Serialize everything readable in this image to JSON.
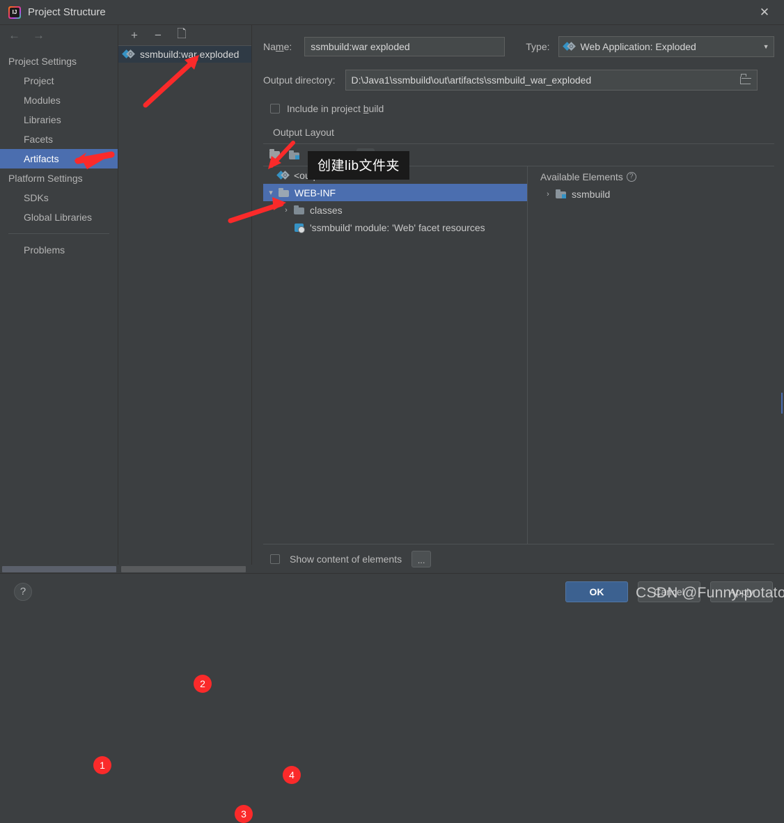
{
  "window": {
    "title": "Project Structure",
    "close_icon": "close-icon",
    "app_icon": "intellij-idea-logo"
  },
  "sidebar": {
    "back_icon": "arrow-left-icon",
    "forward_icon": "arrow-right-icon",
    "groups": [
      {
        "label": "Project Settings",
        "items": [
          {
            "label": "Project",
            "selected": false
          },
          {
            "label": "Modules",
            "selected": false
          },
          {
            "label": "Libraries",
            "selected": false
          },
          {
            "label": "Facets",
            "selected": false
          },
          {
            "label": "Artifacts",
            "selected": true
          }
        ]
      },
      {
        "label": "Platform Settings",
        "items": [
          {
            "label": "SDKs",
            "selected": false
          },
          {
            "label": "Global Libraries",
            "selected": false
          }
        ]
      }
    ],
    "problems_label": "Problems"
  },
  "artifacts_panel": {
    "toolbar": {
      "add_label": "+",
      "remove_label": "−",
      "copy_icon": "copy-icon"
    },
    "items": [
      {
        "label": "ssmbuild:war exploded",
        "selected": true,
        "icon": "artifact-icon"
      }
    ]
  },
  "form": {
    "name_label_before": "Na",
    "name_label_mnemonic": "m",
    "name_label_after": "e:",
    "name_value": "ssmbuild:war exploded",
    "type_label": "Type:",
    "type_value": "Web Application: Exploded",
    "type_icon": "artifact-icon",
    "type_dropdown_icon": "chevron-down-icon",
    "output_dir_label": "Output directory:",
    "output_dir_value": "D:\\Java1\\ssmbuild\\out\\artifacts\\ssmbuild_war_exploded",
    "browse_icon": "folder-browse-icon",
    "include_in_build_before": "Include in project ",
    "include_in_build_mnemonic": "b",
    "include_in_build_after": "uild",
    "include_in_build_checked": false,
    "output_layout_label": "Output Layout"
  },
  "layout_toolbar": {
    "create_dir_icon": "create-directory-icon",
    "add_icon": "plus-icon",
    "module_icon": "module-icon",
    "dropdown_icon": "chevron-down-icon"
  },
  "tooltip": {
    "text": "创建lib文件夹"
  },
  "output_tree": [
    {
      "label": "<output root>",
      "icon": "artifact-icon",
      "indent": 0,
      "twist": "",
      "selected": false
    },
    {
      "label": "WEB-INF",
      "icon": "folder-icon",
      "indent": 0,
      "twist": "⌄",
      "selected": true
    },
    {
      "label": "classes",
      "icon": "folder-icon",
      "indent": 1,
      "twist": "›",
      "selected": false
    },
    {
      "label": "'ssmbuild' module: 'Web' facet resources",
      "icon": "module-facet-icon",
      "indent": 1,
      "twist": "",
      "selected": false
    }
  ],
  "available_elements": {
    "title": "Available Elements",
    "help_icon": "help-circle-icon",
    "items": [
      {
        "label": "ssmbuild",
        "icon": "module-icon",
        "twist": "›"
      }
    ]
  },
  "bottom": {
    "show_content_label": "Show content of elements",
    "show_content_checked": false,
    "dots_label": "..."
  },
  "footer": {
    "help_label": "?",
    "ok_label": "OK",
    "cancel_label": "Cancel",
    "apply_label": "Apply"
  },
  "annotations": {
    "markers": [
      {
        "id": "1",
        "target": "sidebar-item-artifacts"
      },
      {
        "id": "2",
        "target": "artifact-list-item"
      },
      {
        "id": "3",
        "target": "output-tree-web-inf"
      },
      {
        "id": "4",
        "target": "create-directory-button"
      }
    ]
  },
  "watermark": {
    "text": "CSDN @Funny-potato"
  }
}
